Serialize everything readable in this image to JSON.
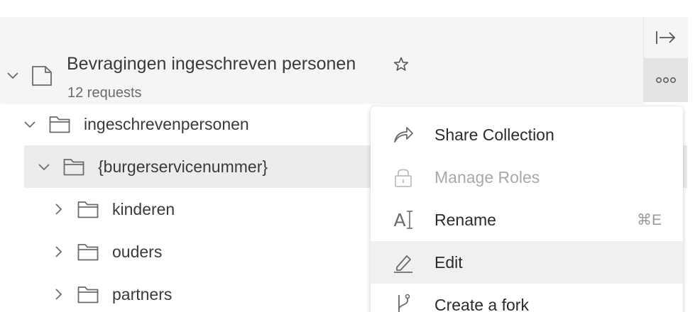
{
  "collection": {
    "title": "Bevragingen ingeschreven personen",
    "request_count": "12 requests"
  },
  "tree": {
    "rows": [
      {
        "label": "ingeschrevenpersonen"
      },
      {
        "label": "{burgerservicenummer}"
      },
      {
        "label": "kinderen"
      },
      {
        "label": "ouders"
      },
      {
        "label": "partners"
      }
    ]
  },
  "context_menu": {
    "items": [
      {
        "label": "Share Collection",
        "icon": "share-icon",
        "shortcut": ""
      },
      {
        "label": "Manage Roles",
        "icon": "lock-icon",
        "shortcut": "",
        "disabled": true
      },
      {
        "label": "Rename",
        "icon": "rename-icon",
        "icon_text": "A",
        "shortcut": "⌘E"
      },
      {
        "label": "Edit",
        "icon": "pencil-icon",
        "shortcut": ""
      },
      {
        "label": "Create a fork",
        "icon": "fork-icon",
        "shortcut": ""
      }
    ]
  },
  "colors": {
    "header_bg": "#f5f5f5",
    "selected_row_bg": "#ececec",
    "menu_hover_bg": "#f0f0f0",
    "disabled_text": "#a8a8a8"
  }
}
